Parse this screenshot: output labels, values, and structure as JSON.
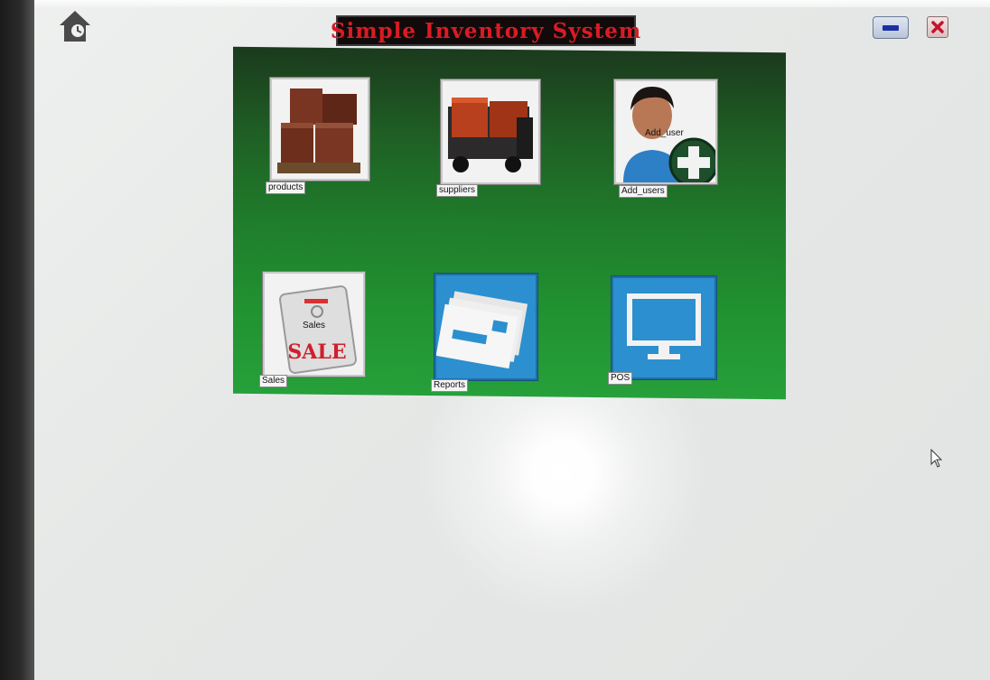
{
  "window": {
    "title": "Simple Inventory System",
    "title_color": "#d91c24",
    "panel_color": "#1f7c2b"
  },
  "tiles": [
    {
      "label": "products",
      "icon": "boxes-on-pallet-icon"
    },
    {
      "label": "suppliers",
      "icon": "delivery-truck-icon"
    },
    {
      "label": "Add_users",
      "overlay": "Add_user",
      "icon": "add-user-icon"
    },
    {
      "label": "Sales",
      "overlay": "Sales",
      "icon": "sale-tag-icon",
      "tag_text": "SALE"
    },
    {
      "label": "Reports",
      "icon": "reports-envelopes-icon"
    },
    {
      "label": "POS",
      "icon": "monitor-icon"
    }
  ]
}
